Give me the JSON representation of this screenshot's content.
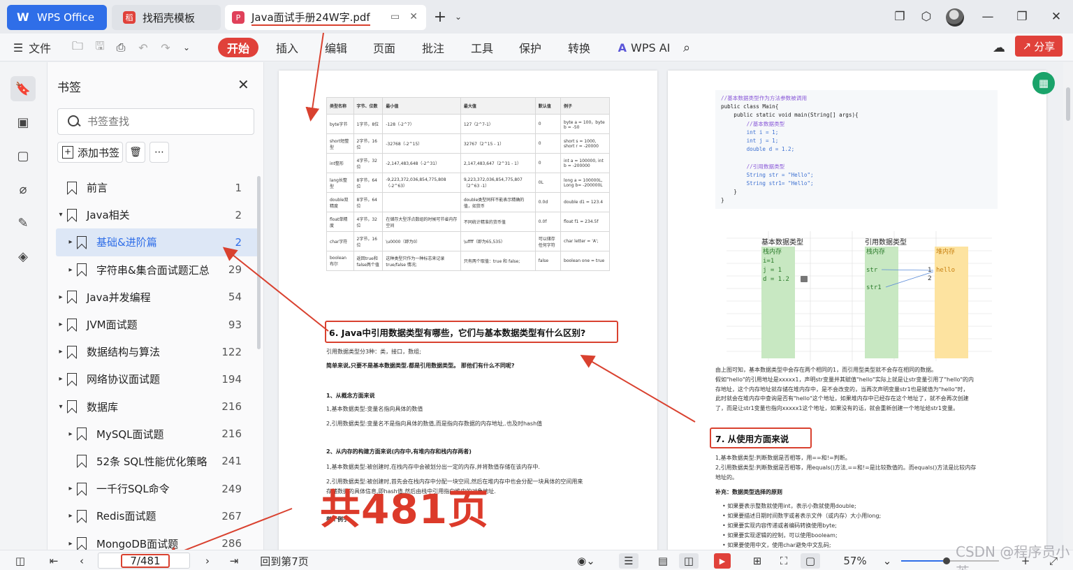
{
  "tabs": {
    "wps_label": "WPS Office",
    "template_tab": "找稻壳模板",
    "pdf_tab": "Java面试手册24W字.pdf"
  },
  "toolbar": {
    "file_label": "文件",
    "menus": [
      "开始",
      "插入",
      "编辑",
      "页面",
      "批注",
      "工具",
      "保护",
      "转换"
    ],
    "wps_ai": "WPS AI",
    "share": "分享"
  },
  "bookmarks": {
    "title": "书签",
    "search_placeholder": "书签查找",
    "add_label": "添加书签",
    "items": [
      {
        "label": "前言",
        "page": "1",
        "level": 0,
        "arrow": ""
      },
      {
        "label": "Java相关",
        "page": "2",
        "level": 0,
        "arrow": "▾"
      },
      {
        "label": "基础&进阶篇",
        "page": "2",
        "level": 1,
        "arrow": "▸"
      },
      {
        "label": "字符串&集合面试题汇总",
        "page": "29",
        "level": 1,
        "arrow": "▸"
      },
      {
        "label": "Java并发编程",
        "page": "54",
        "level": 0,
        "arrow": "▸"
      },
      {
        "label": "JVM面试题",
        "page": "93",
        "level": 0,
        "arrow": "▸"
      },
      {
        "label": "数据结构与算法",
        "page": "122",
        "level": 0,
        "arrow": "▸"
      },
      {
        "label": "网络协议面试题",
        "page": "194",
        "level": 0,
        "arrow": "▸"
      },
      {
        "label": "数据库",
        "page": "216",
        "level": 0,
        "arrow": "▾"
      },
      {
        "label": "MySQL面试题",
        "page": "216",
        "level": 1,
        "arrow": "▸"
      },
      {
        "label": "52条 SQL性能优化策略",
        "page": "241",
        "level": 1,
        "arrow": ""
      },
      {
        "label": "一千行SQL命令",
        "page": "249",
        "level": 1,
        "arrow": "▸"
      },
      {
        "label": "Redis面试题",
        "page": "267",
        "level": 1,
        "arrow": "▸"
      },
      {
        "label": "MongoDB面试题",
        "page": "286",
        "level": 1,
        "arrow": "▸"
      }
    ]
  },
  "page1": {
    "table_headers": [
      "类型名称",
      "字节、位数",
      "最小值",
      "最大值",
      "默认值",
      "例子"
    ],
    "table_rows": [
      [
        "byte字节",
        "1字节，8位",
        "-128（-2^7）",
        "127（2^7-1）",
        "0",
        "byte a = 100，byte b = -50"
      ],
      [
        "short短整型",
        "2字节，16位",
        "-32768（-2^15）",
        "32767（2^15 - 1）",
        "0",
        "short s = 1000, short r = -20000"
      ],
      [
        "int整形",
        "4字节，32位",
        "-2,147,483,648（-2^31）",
        "2,147,483,647（2^31 - 1）",
        "0",
        "int a = 100000, int b = -200000"
      ],
      [
        "lang长整型",
        "8字节，64位",
        "-9,223,372,036,854,775,808（-2^63）",
        "9,223,372,036,854,775,807（2^63 -1）",
        "0L",
        "long a = 100000L, Long b= -200000L"
      ],
      [
        "double双精度",
        "8字节，64位",
        "",
        "double类型同样不能表示精确的值，如货币",
        "0.0d",
        "double d1 = 123.4"
      ],
      [
        "float单精度",
        "4字节，32位",
        "在储存大型浮点数组的时候可节省内存空间",
        "不同统计精准的货币值",
        "0.0f",
        "float f1 = 234.5f"
      ],
      [
        "char字符",
        "2字节，16位",
        "\\u0000（即为0）",
        "\\uffff（即为65,535）",
        "可以储存任何字符",
        "char letter = 'A';"
      ],
      [
        "boolean布尔",
        "返回true和false两个值",
        "这种类型只作为一种标志来记录true/false 情况;",
        "只有两个取值：true 和 false;",
        "false",
        "boolean one = true"
      ]
    ],
    "heading": "6. Java中引用数据类型有哪些，它们与基本数据类型有什么区别?",
    "lines": [
      "引用数据类型分3种：类，接口，数组;",
      "简单来说,只要不是基本数据类型.都是引用数据类型。 那他们有什么不同呢?",
      "1、从概念方面来说",
      "1,基本数据类型:变量名指向具体的数值",
      "2,引用数据类型:变量名不是指向具体的数值,而是指向存数据的内存地址,.也及时hash值",
      "2、从内存的构建方面来说(内存中,有堆内存和栈内存两者)",
      "1,基本数据类型:被创建时,在栈内存中会被划分出一定的内存,并将数值存储在该内存中.",
      "2,引用数据类型:被创建时,首先会在栈内存中分配一块空间,然后在堆内存中也会分配一块具体的空间用来",
      "存储数据的具体信息,即hash值,然后由栈中引用指向堆中的对象地址.",
      "举个例子"
    ]
  },
  "page2": {
    "code": [
      "//基本数据类型作为方法参数被调用",
      "public class Main{",
      "    public static void main(String[] args){",
      "        //基本数据类型",
      "        int i = 1;",
      "        int j = 1;",
      "        double d = 1.2;",
      "",
      "        //引用数据类型",
      "        String str = \"Hello\";",
      "        String str1= \"Hello\";",
      "    }",
      "}"
    ],
    "diagram": {
      "basic_title": "基本数据类型",
      "ref_title": "引用数据类型",
      "stack1": "栈内存",
      "stack2": "栈内存",
      "heap": "堆内存",
      "var1": "i=1",
      "var2": "j = 1",
      "var3": "d = 1.2",
      "ref1": "str",
      "ref2": "str1",
      "heap_val": "hello",
      "addr1": "1",
      "addr2": "2"
    },
    "para": [
      "由上图可知，基本数据类型中会存在两个相同的1，而引用型类型就不会存在相同的数据。",
      "假如\"hello\"的引用地址是xxxxx1，声明str变量并其赋值\"hello\"实际上就是让str变量引用了\"hello\"的内",
      "存地址，这个内存地址就存储在堆内存中，是不会改变的，当再次声明变量str1也是赋值为\"hello\"时，",
      "此时就会在堆内存中查询是否有\"hello\"这个地址，如果堆内存中已经存在这个地址了，就不会再次创建",
      "了，而是让str1变量也指向xxxxx1这个地址，如果没有的话，就会重新创建一个地址给str1变量。"
    ],
    "heading": "7. 从使用方面来说",
    "usage": [
      "1,基本数据类型:判断数据是否相等，用==和!=判断。",
      "2,引用数据类型:判断数据是否相等，用equals()方法,==和!=是比较数值的。而equals()方法是比较内存",
      "地址的。",
      "补充：数据类型选择的原则",
      "• 如果要表示整数就使用int，表示小数就使用double;",
      "• 如果要描述日期时间数字或者表示文件（或内存）大小用long;",
      "• 如果要实现内容传递或者编码转换使用byte;",
      "• 如果要实现逻辑的控制，可以使用booleam;",
      "• 如果要使用中文，使用char避免中文乱码;"
    ]
  },
  "overlay": {
    "total_pages": "共481页",
    "watermark": "CSDN @程序员小英"
  },
  "statusbar": {
    "page_value": "7/481",
    "goto_label": "回到第7页",
    "zoom": "57%"
  },
  "colors": {
    "accent_red": "#e0413a",
    "wps_blue": "#2f6ee8",
    "annotation_red": "#d9412f"
  }
}
